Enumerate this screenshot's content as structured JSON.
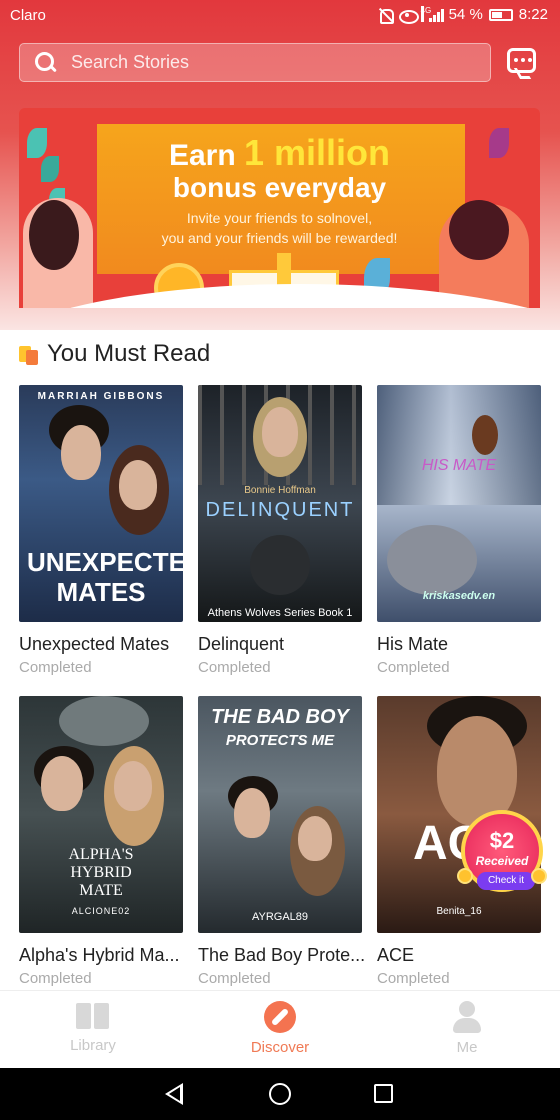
{
  "status_bar": {
    "carrier": "Claro",
    "network": "4G",
    "battery": "54 %",
    "time": "8:22"
  },
  "search": {
    "placeholder": "Search Stories"
  },
  "banner": {
    "title_prefix": "Earn",
    "title_highlight": "1 million",
    "title_line2": "bonus everyday",
    "subtitle_line1": "Invite your friends to solnovel,",
    "subtitle_line2": "you and your friends will be rewarded!"
  },
  "section": {
    "title": "You Must Read"
  },
  "books": [
    {
      "title": "Unexpected Mates",
      "status": "Completed",
      "cover_author": "MARRIAH GIBBONS",
      "cover_title": "UNEXPECTED MATES"
    },
    {
      "title": "Delinquent",
      "status": "Completed",
      "cover_author": "Bonnie Hoffman",
      "cover_title": "DELINQUENT",
      "cover_series": "Athens Wolves Series Book 1"
    },
    {
      "title": "His Mate",
      "status": "Completed",
      "cover_title": "HIS MATE",
      "cover_author": "kriskasedv.en"
    },
    {
      "title": "Alpha's Hybrid Ma...",
      "status": "Completed",
      "cover_title": "ALPHA'S HYBRID MATE",
      "cover_author": "ALCIONE02"
    },
    {
      "title": "The Bad Boy Prote...",
      "status": "Completed",
      "cover_title_line1": "THE BAD BOY",
      "cover_title_line2": "PROTECTS ME",
      "cover_author": "AYRGAL89"
    },
    {
      "title": "ACE",
      "status": "Completed",
      "cover_title": "AC",
      "cover_author": "Benita_16"
    }
  ],
  "reward_badge": {
    "amount": "$2",
    "label": "Received",
    "button": "Check it"
  },
  "bottom_nav": [
    {
      "label": "Library",
      "icon": "library-icon",
      "active": false
    },
    {
      "label": "Discover",
      "icon": "compass-icon",
      "active": true
    },
    {
      "label": "Me",
      "icon": "person-icon",
      "active": false
    }
  ],
  "colors": {
    "accent": "#f07a55",
    "header": "#e2383d",
    "inactive": "#c8c8c8"
  }
}
